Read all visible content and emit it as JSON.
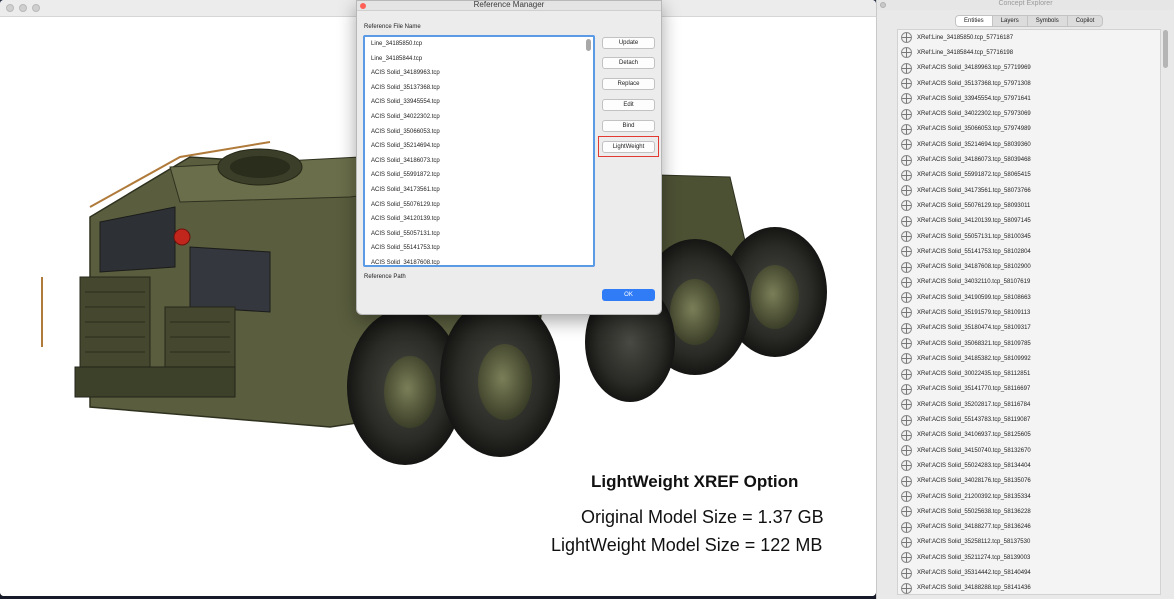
{
  "main_window": {
    "caption_title": "LightWeight XREF Option",
    "caption_original": "Original Model Size = 1.37 GB",
    "caption_lightweight": "LightWeight Model Size = 122 MB"
  },
  "reference_manager": {
    "title": "Reference Manager",
    "file_name_label": "Reference File Name",
    "path_label": "Reference Path",
    "files": [
      "Line_34185850.tcp",
      "Line_34185844.tcp",
      "ACIS Solid_34189963.tcp",
      "ACIS Solid_35137368.tcp",
      "ACIS Solid_33945554.tcp",
      "ACIS Solid_34022302.tcp",
      "ACIS Solid_35066053.tcp",
      "ACIS Solid_35214694.tcp",
      "ACIS Solid_34186073.tcp",
      "ACIS Solid_55991872.tcp",
      "ACIS Solid_34173561.tcp",
      "ACIS Solid_55076129.tcp",
      "ACIS Solid_34120139.tcp",
      "ACIS Solid_55057131.tcp",
      "ACIS Solid_55141753.tcp",
      "ACIS Solid_34187608.tcp"
    ],
    "buttons": {
      "update": "Update",
      "detach": "Detach",
      "replace": "Replace",
      "edit": "Edit",
      "bind": "Bind",
      "lightweight": "LightWeight"
    },
    "ok": "OK"
  },
  "explorer": {
    "title": "Concept Explorer",
    "tabs": [
      "Entities",
      "Layers",
      "Symbols",
      "Copilot"
    ],
    "active_tab": "Entities",
    "entities": [
      "XRef:Line_34185850.tcp_57716187",
      "XRef:Line_34185844.tcp_57716198",
      "XRef:ACIS Solid_34189963.tcp_57719969",
      "XRef:ACIS Solid_35137368.tcp_57971308",
      "XRef:ACIS Solid_33945554.tcp_57971641",
      "XRef:ACIS Solid_34022302.tcp_57973069",
      "XRef:ACIS Solid_35066053.tcp_57974989",
      "XRef:ACIS Solid_35214694.tcp_58039360",
      "XRef:ACIS Solid_34186073.tcp_58039468",
      "XRef:ACIS Solid_55991872.tcp_58065415",
      "XRef:ACIS Solid_34173561.tcp_58073766",
      "XRef:ACIS Solid_55076129.tcp_58093011",
      "XRef:ACIS Solid_34120139.tcp_58097145",
      "XRef:ACIS Solid_55057131.tcp_58100345",
      "XRef:ACIS Solid_55141753.tcp_58102804",
      "XRef:ACIS Solid_34187608.tcp_58102900",
      "XRef:ACIS Solid_34032110.tcp_58107619",
      "XRef:ACIS Solid_34190599.tcp_58108663",
      "XRef:ACIS Solid_35191579.tcp_58109113",
      "XRef:ACIS Solid_35180474.tcp_58109317",
      "XRef:ACIS Solid_35068321.tcp_58109785",
      "XRef:ACIS Solid_34185382.tcp_58109992",
      "XRef:ACIS Solid_30022435.tcp_58112851",
      "XRef:ACIS Solid_35141770.tcp_58116697",
      "XRef:ACIS Solid_35202817.tcp_58116784",
      "XRef:ACIS Solid_55143783.tcp_58119087",
      "XRef:ACIS Solid_34106937.tcp_58125605",
      "XRef:ACIS Solid_34150740.tcp_58132670",
      "XRef:ACIS Solid_55024283.tcp_58134404",
      "XRef:ACIS Solid_34028176.tcp_58135076",
      "XRef:ACIS Solid_21200392.tcp_58135334",
      "XRef:ACIS Solid_55025638.tcp_58136228",
      "XRef:ACIS Solid_34188277.tcp_58136246",
      "XRef:ACIS Solid_35258112.tcp_58137530",
      "XRef:ACIS Solid_35211274.tcp_58139003",
      "XRef:ACIS Solid_35314442.tcp_58140494",
      "XRef:ACIS Solid_34188288.tcp_58141436"
    ]
  },
  "colors": {
    "accent_blue": "#2f7cf6",
    "highlight_red": "#e23a33",
    "truck_olive": "#5a5e3e"
  }
}
